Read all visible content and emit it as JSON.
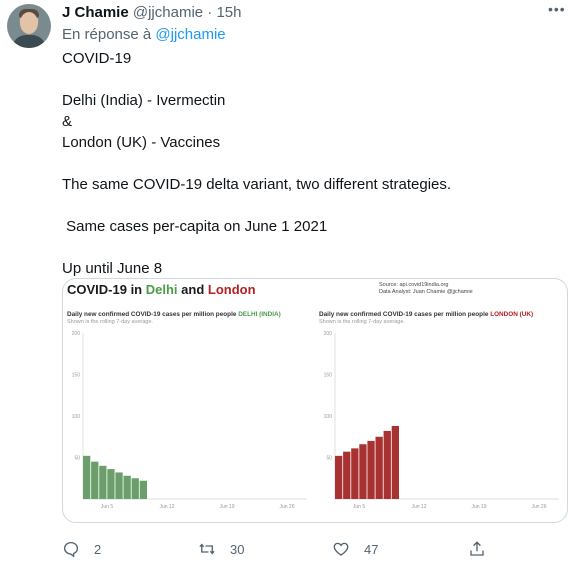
{
  "tweet": {
    "author_name": "J Chamie",
    "author_meta": "@jjchamie · 15h",
    "reply_prefix": "En réponse à ",
    "reply_handle": "@jjchamie",
    "lines": [
      "COVID-19",
      "",
      "Delhi (India) - Ivermectin",
      "&",
      "London (UK) - Vaccines",
      "",
      "The same COVID-19 delta variant, two different strategies.",
      "",
      " Same cases per-capita on June 1 2021",
      "",
      "Up until June 8"
    ]
  },
  "media": {
    "title_prefix": "COVID-19 in ",
    "title_delhi": "Delhi",
    "title_and": " and ",
    "title_london": "London",
    "source_line1": "Source: api.covid19india.org",
    "source_line2": "Data Analyst:  Juan Chamie @jjchamie",
    "colors": {
      "delhi": "#6b9e6b",
      "london": "#a83232"
    }
  },
  "chart_data": [
    {
      "type": "bar",
      "title": "Daily new confirmed COVID-19 cases per million people DELHI (INDIA)",
      "subtitle": "Shown is the rolling 7-day average.",
      "y_ticks": [
        "200",
        "150",
        "100",
        "50"
      ],
      "ylim": [
        0,
        200
      ],
      "x_ticks": [
        "Jun 5",
        "Jun 12",
        "Jun 19",
        "Jun 26"
      ],
      "values": [
        52,
        45,
        40,
        36,
        32,
        28,
        25,
        22
      ]
    },
    {
      "type": "bar",
      "title": "Daily new confirmed COVID-19 cases per million people LONDON (UK)",
      "subtitle": "Shown is the rolling 7-day average.",
      "y_ticks": [
        "200",
        "150",
        "100",
        "50"
      ],
      "ylim": [
        0,
        200
      ],
      "x_ticks": [
        "Jun 5",
        "Jun 12",
        "Jun 19",
        "Jun 26"
      ],
      "values": [
        52,
        57,
        61,
        66,
        70,
        75,
        82,
        88
      ]
    }
  ],
  "actions": {
    "reply_count": "2",
    "retweet_count": "30",
    "like_count": "47"
  }
}
